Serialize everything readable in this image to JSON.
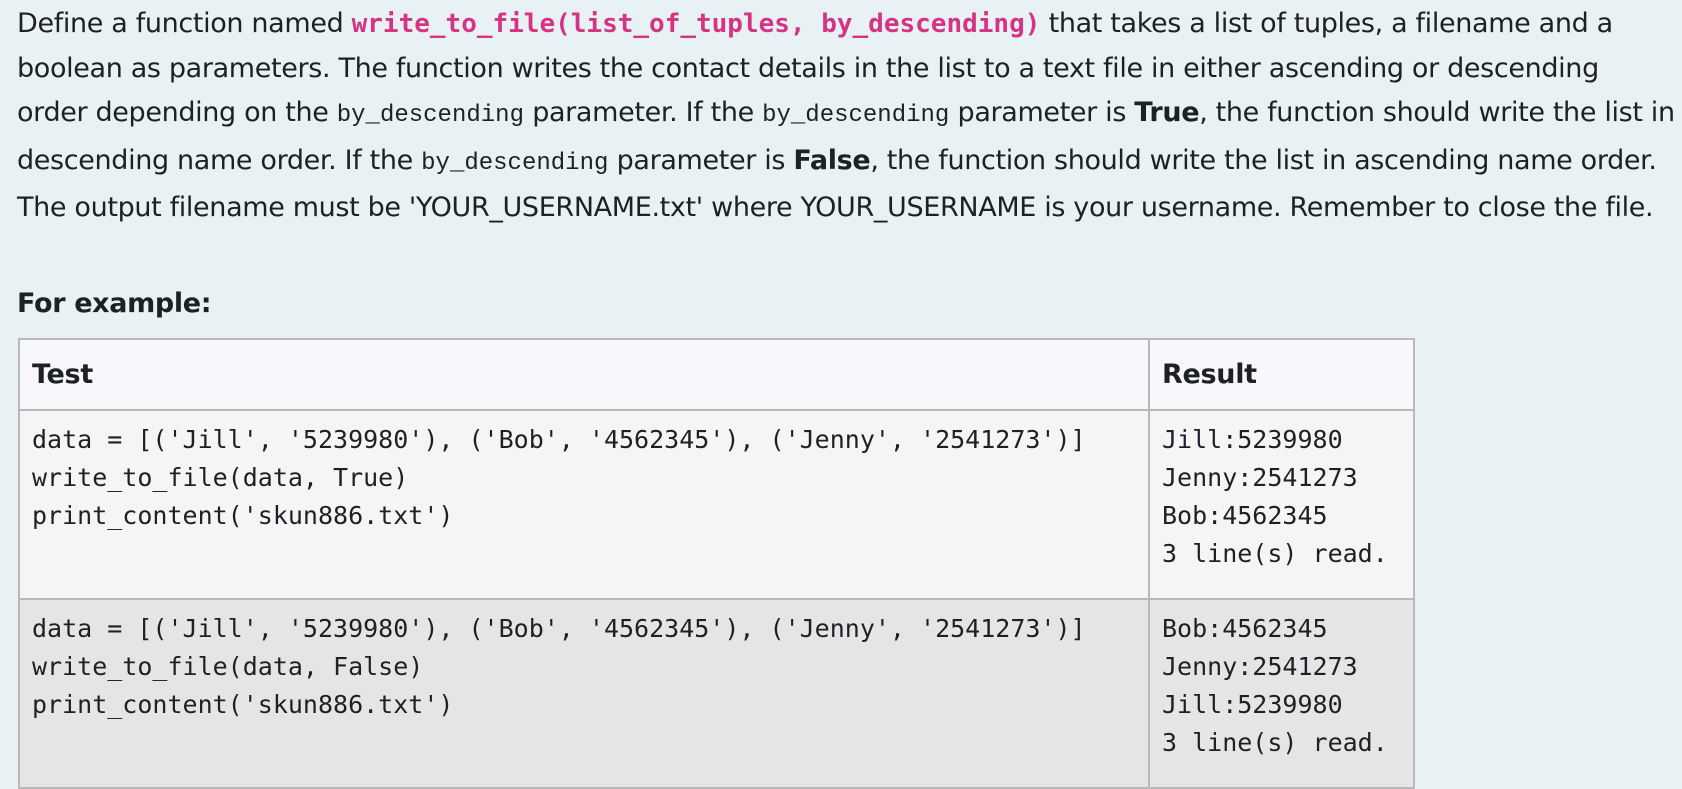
{
  "question": {
    "t1": "Define a function named ",
    "function_signature": "write_to_file(list_of_tuples, by_descending)",
    "t2": " that takes a list of tuples, a filename and a boolean as parameters. The function writes the contact details in the list to a text file in either ascending or descending order depending on the ",
    "param_code_1": "by_descending",
    "t3": " parameter. If the ",
    "param_code_2": "by_descending",
    "t4": " parameter is ",
    "true_label": "True",
    "t5": ", the function should write the list in descending name order. If the ",
    "param_code_3": "by_descending",
    "t6": " parameter is ",
    "false_label": "False",
    "t7": ", the function should write the list in ascending name order. The output filename must be 'YOUR_USERNAME.txt' where YOUR_USERNAME is your username. Remember to close the file."
  },
  "example_heading": "For example:",
  "table": {
    "headers": {
      "test": "Test",
      "result": "Result"
    },
    "rows": [
      {
        "test": "data = [('Jill', '5239980'), ('Bob', '4562345'), ('Jenny', '2541273')]\nwrite_to_file(data, True)\nprint_content('skun886.txt')",
        "result": "Jill:5239980\nJenny:2541273\nBob:4562345\n3 line(s) read."
      },
      {
        "test": "data = [('Jill', '5239980'), ('Bob', '4562345'), ('Jenny', '2541273')]\nwrite_to_file(data, False)\nprint_content('skun886.txt')",
        "result": "Bob:4562345\nJenny:2541273\nJill:5239980\n3 line(s) read."
      }
    ]
  },
  "colors": {
    "page_background": "#e8f1f3",
    "function_code": "#d63384",
    "header_background": "#f7f7fc",
    "row_odd_background": "#f5f5f5",
    "row_even_background": "#e5e5e5",
    "border": "#b9b9b9"
  }
}
